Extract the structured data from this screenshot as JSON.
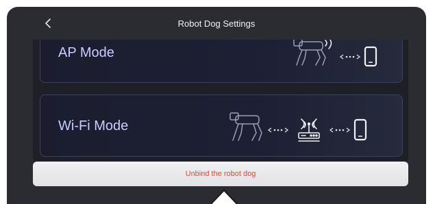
{
  "header": {
    "title": "Robot Dog Settings"
  },
  "modes": [
    {
      "title": "AP Mode"
    },
    {
      "title": "Wi-Fi Mode"
    }
  ],
  "actions": {
    "unbind_label": "Unbind the robot dog"
  },
  "icons": {
    "back": "chevron-left-icon",
    "robot": "robot-dog-icon",
    "link": "dotted-link-icon",
    "router": "wifi-router-icon",
    "phone": "phone-icon"
  },
  "colors": {
    "background": "#2b2c31",
    "card_text": "#c9ccff",
    "danger_text": "#e2453b",
    "button_bg": "#eeeef1"
  }
}
